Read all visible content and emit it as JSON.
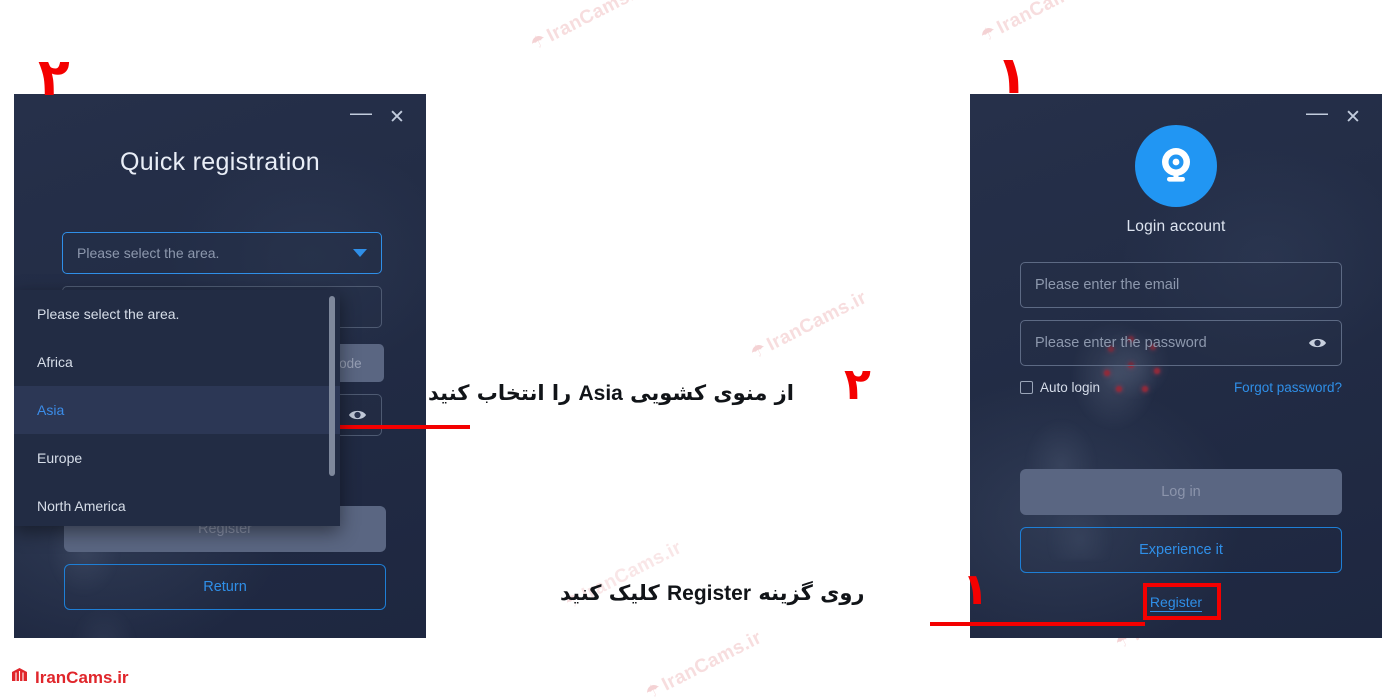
{
  "brand": {
    "name": "IranCams.ir",
    "color": "#e0262b",
    "logo_icon": "irancams-logo-icon"
  },
  "watermark": {
    "text": "IranCams.ir",
    "color": "#f3c9cb"
  },
  "accent": {
    "blue": "#2f8fe8",
    "annotation_red": "#f40000",
    "avatar_blue": "#2196f3"
  },
  "login_window": {
    "marker_number": "۱",
    "titlebar": {
      "minimize": "—",
      "close": "✕"
    },
    "avatar_icon": "camera-avatar-icon",
    "title": "Login account",
    "email_field": {
      "placeholder": "Please enter the email",
      "value": ""
    },
    "password_field": {
      "placeholder": "Please enter the password",
      "value": "",
      "toggle_icon": "eye-icon"
    },
    "auto_login": {
      "label": "Auto login",
      "checked": false
    },
    "forgot_password": "Forgot password?",
    "login_button": "Log in",
    "experience_button": "Experience it",
    "register_link": "Register"
  },
  "register_window": {
    "marker_number": "۲",
    "titlebar": {
      "minimize": "—",
      "close": "✕"
    },
    "title": "Quick registration",
    "area_select": {
      "value": "Please select the area.",
      "caret_icon": "chevron-down-icon"
    },
    "email_field": {
      "placeholder": "",
      "value": ""
    },
    "code_button": "code",
    "password_field": {
      "placeholder": "",
      "value": "",
      "toggle_icon": "eye-icon"
    },
    "register_button": "Register",
    "return_button": "Return",
    "dropdown": {
      "options": [
        {
          "label": "Please select the area.",
          "selected": false
        },
        {
          "label": "Africa",
          "selected": false
        },
        {
          "label": "Asia",
          "selected": true
        },
        {
          "label": "Europe",
          "selected": false
        },
        {
          "label": "North America",
          "selected": false
        }
      ]
    }
  },
  "annotations": [
    {
      "marker": "۱",
      "text_rtl": "روی گزینه",
      "text_latin": "Register",
      "text_rtl_2": "کلیک کنید"
    },
    {
      "marker": "۲",
      "text_rtl": "از منوی کشویی",
      "text_latin": "Asia",
      "text_rtl_2": "را انتخاب کنید"
    }
  ]
}
